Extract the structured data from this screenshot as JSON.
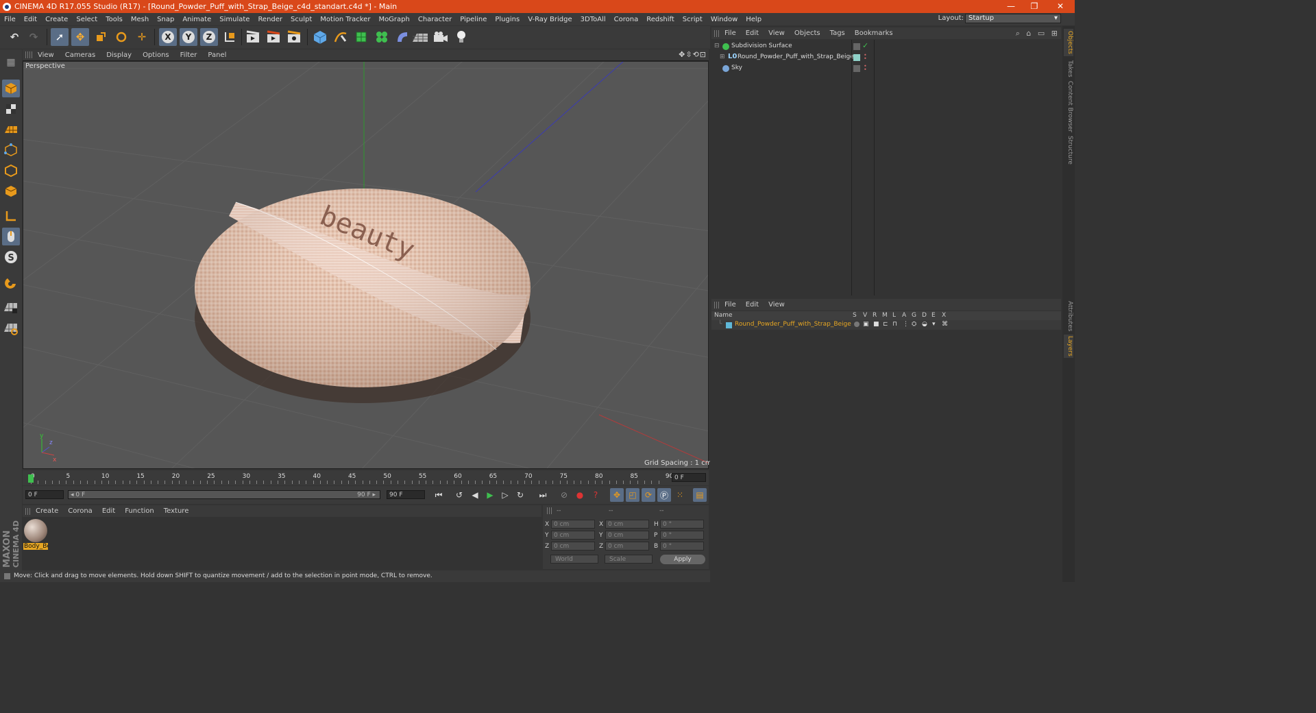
{
  "window": {
    "title": "CINEMA 4D R17.055 Studio (R17) - [Round_Powder_Puff_with_Strap_Beige_c4d_standart.c4d *] - Main",
    "minimize": "—",
    "restore": "❐",
    "close": "✕"
  },
  "menubar": {
    "items": [
      "File",
      "Edit",
      "Create",
      "Select",
      "Tools",
      "Mesh",
      "Snap",
      "Animate",
      "Simulate",
      "Render",
      "Sculpt",
      "Motion Tracker",
      "MoGraph",
      "Character",
      "Pipeline",
      "Plugins",
      "V-Ray Bridge",
      "3DToAll",
      "Corona",
      "Redshift",
      "Script",
      "Window",
      "Help"
    ],
    "layout_label": "Layout:",
    "layout_value": "Startup"
  },
  "toolbar": {
    "axis_x": "X",
    "axis_y": "Y",
    "axis_z": "Z"
  },
  "viewport": {
    "menu": [
      "View",
      "Cameras",
      "Display",
      "Options",
      "Filter",
      "Panel"
    ],
    "nav_icons": "✥⇳⟲⊡",
    "label": "Perspective",
    "grid_spacing": "Grid Spacing : 1 cm",
    "object_text": "beauty",
    "axis_y_label": "y",
    "axis_z_label": "z",
    "axis_x_label": "x"
  },
  "timeline": {
    "ticks": [
      "0",
      "5",
      "10",
      "15",
      "20",
      "25",
      "30",
      "35",
      "40",
      "45",
      "50",
      "55",
      "60",
      "65",
      "70",
      "75",
      "80",
      "85",
      "90"
    ],
    "current_field": "0 F"
  },
  "transport": {
    "start_field": "0 F",
    "range_start": "◂ 0 F",
    "range_end": "90 F ▸",
    "end_field": "90 F"
  },
  "material_manager": {
    "menu": [
      "Create",
      "Corona",
      "Edit",
      "Function",
      "Texture"
    ],
    "material_name": "Body_Be"
  },
  "coordinates": {
    "head": [
      "--",
      "--",
      "--"
    ],
    "rows": [
      {
        "a": "X",
        "av": "0 cm",
        "b": "X",
        "bv": "0 cm",
        "c": "H",
        "cv": "0 °"
      },
      {
        "a": "Y",
        "av": "0 cm",
        "b": "Y",
        "bv": "0 cm",
        "c": "P",
        "cv": "0 °"
      },
      {
        "a": "Z",
        "av": "0 cm",
        "b": "Z",
        "bv": "0 cm",
        "c": "B",
        "cv": "0 °"
      }
    ],
    "world": "World",
    "scale": "Scale",
    "apply": "Apply"
  },
  "status": "Move: Click and drag to move elements. Hold down SHIFT to quantize movement / add to the selection in point mode, CTRL to remove.",
  "maxon": {
    "line1": "MAXON",
    "line2": "CINEMA 4D"
  },
  "object_manager": {
    "menu": [
      "File",
      "Edit",
      "View",
      "Objects",
      "Tags",
      "Bookmarks"
    ],
    "icons": "⌕ ⌂ ▭ ⊞",
    "objects": [
      {
        "name": "Subdivision Surface",
        "color": "#3fbf4f"
      },
      {
        "name": "Round_Powder_Puff_with_Strap_Beige",
        "color": "#9bd4ff"
      },
      {
        "name": "Sky",
        "color": "#7aa6d8"
      }
    ]
  },
  "layer_manager": {
    "menu": [
      "File",
      "Edit",
      "View"
    ],
    "header": {
      "name": "Name",
      "cols": [
        "S",
        "V",
        "R",
        "M",
        "L",
        "A",
        "G",
        "D",
        "E",
        "X"
      ]
    },
    "layer_name": "Round_Powder_Puff_with_Strap_Beige",
    "layer_color": "#5fb8d8"
  },
  "side_tabs": [
    "Objects",
    "Takes",
    "Content Browser",
    "Structure",
    "Attributes",
    "Layers"
  ],
  "colors": {
    "titlebar": "#d9481a",
    "selection": "#5a6d86",
    "accent": "#e6a623"
  }
}
